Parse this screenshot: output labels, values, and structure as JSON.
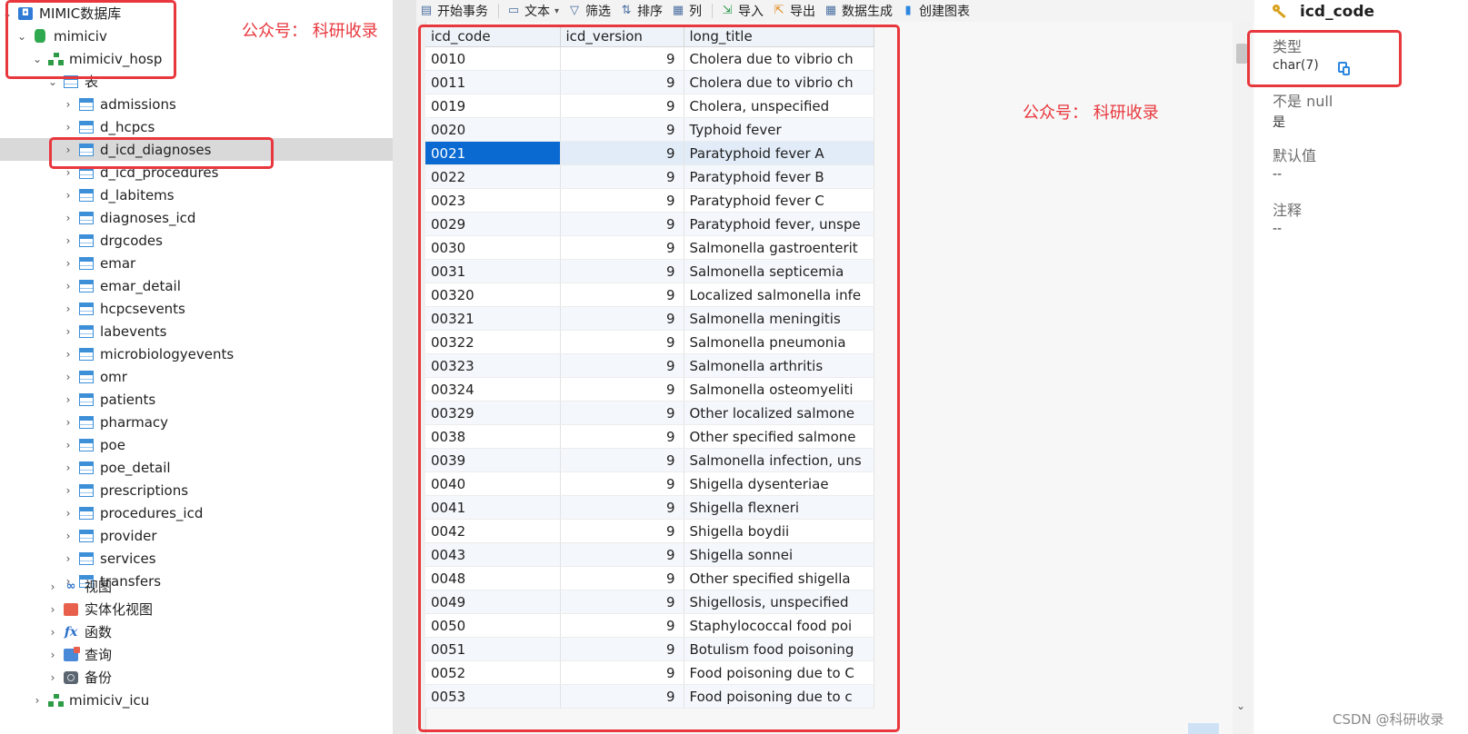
{
  "sidebar": {
    "connection": "MIMIC数据库",
    "database": "mimiciv",
    "schema": "mimiciv_hosp",
    "tables_group": "表",
    "tables": [
      "admissions",
      "d_hcpcs",
      "d_icd_diagnoses",
      "d_icd_procedures",
      "d_labitems",
      "diagnoses_icd",
      "drgcodes",
      "emar",
      "emar_detail",
      "hcpcsevents",
      "labevents",
      "microbiologyevents",
      "omr",
      "patients",
      "pharmacy",
      "poe",
      "poe_detail",
      "prescriptions",
      "procedures_icd",
      "provider",
      "services",
      "transfers"
    ],
    "selected_table": "d_icd_diagnoses",
    "other_groups": [
      "视图",
      "实体化视图",
      "函数",
      "查询",
      "备份"
    ],
    "other_schema": "mimiciv_icu"
  },
  "toolbar": {
    "begin_tx": "开始事务",
    "text": "文本",
    "filter": "筛选",
    "sort": "排序",
    "columns": "列",
    "import": "导入",
    "export": "导出",
    "data_gen": "数据生成",
    "create_chart": "创建图表"
  },
  "grid": {
    "columns": [
      "icd_code",
      "icd_version",
      "long_title"
    ],
    "rows": [
      [
        "0010",
        "9",
        "Cholera due to vibrio ch"
      ],
      [
        "0011",
        "9",
        "Cholera due to vibrio ch"
      ],
      [
        "0019",
        "9",
        "Cholera, unspecified"
      ],
      [
        "0020",
        "9",
        "Typhoid fever"
      ],
      [
        "0021",
        "9",
        "Paratyphoid fever A"
      ],
      [
        "0022",
        "9",
        "Paratyphoid fever B"
      ],
      [
        "0023",
        "9",
        "Paratyphoid fever C"
      ],
      [
        "0029",
        "9",
        "Paratyphoid fever, unspe"
      ],
      [
        "0030",
        "9",
        "Salmonella gastroenterit"
      ],
      [
        "0031",
        "9",
        "Salmonella septicemia"
      ],
      [
        "00320",
        "9",
        "Localized salmonella infe"
      ],
      [
        "00321",
        "9",
        "Salmonella meningitis"
      ],
      [
        "00322",
        "9",
        "Salmonella pneumonia"
      ],
      [
        "00323",
        "9",
        "Salmonella arthritis"
      ],
      [
        "00324",
        "9",
        "Salmonella osteomyeliti"
      ],
      [
        "00329",
        "9",
        "Other localized salmone"
      ],
      [
        "0038",
        "9",
        "Other specified salmone"
      ],
      [
        "0039",
        "9",
        "Salmonella infection, uns"
      ],
      [
        "0040",
        "9",
        "Shigella dysenteriae"
      ],
      [
        "0041",
        "9",
        "Shigella flexneri"
      ],
      [
        "0042",
        "9",
        "Shigella boydii"
      ],
      [
        "0043",
        "9",
        "Shigella sonnei"
      ],
      [
        "0048",
        "9",
        "Other specified shigella"
      ],
      [
        "0049",
        "9",
        "Shigellosis, unspecified"
      ],
      [
        "0050",
        "9",
        "Staphylococcal food poi"
      ],
      [
        "0051",
        "9",
        "Botulism food poisoning"
      ],
      [
        "0052",
        "9",
        "Food poisoning due to C"
      ],
      [
        "0053",
        "9",
        "Food poisoning due to c"
      ]
    ],
    "selected_row": 4
  },
  "info": {
    "field_name": "icd_code",
    "type_label": "类型",
    "type_value": "char(7)",
    "not_null_label": "不是 null",
    "not_null_value": "是",
    "default_label": "默认值",
    "default_value": "--",
    "comment_label": "注释",
    "comment_value": "--"
  },
  "annotations": {
    "note_left": "公众号： 科研收录",
    "note_center": "公众号： 科研收录",
    "watermark": "CSDN @科研收录",
    "color": "#e8373d"
  }
}
